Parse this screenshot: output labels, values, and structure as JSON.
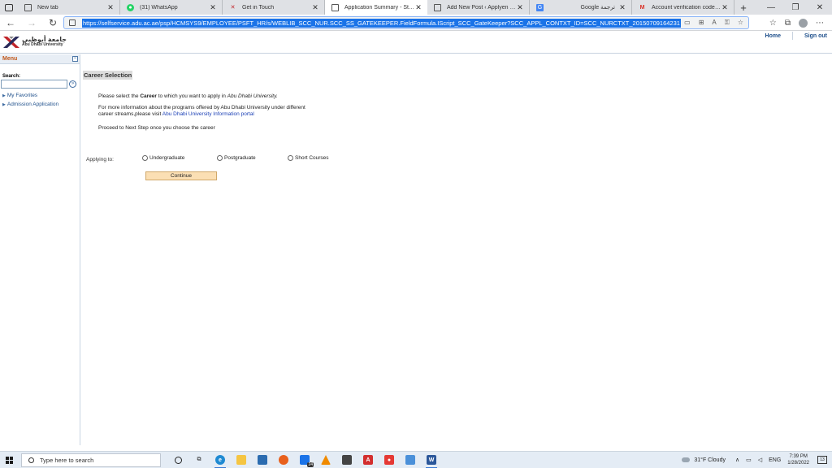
{
  "browser": {
    "tabs": [
      {
        "title": "New tab",
        "icon": "new-tab-icon",
        "active": false
      },
      {
        "title": "(31) WhatsApp",
        "icon": "whatsapp-icon",
        "active": false
      },
      {
        "title": "Get in Touch",
        "icon": "adu-icon",
        "active": false
      },
      {
        "title": "Application Summary - Student",
        "icon": "document-icon",
        "active": true
      },
      {
        "title": "Add New Post ‹ Applyen — Wo…",
        "icon": "document-icon",
        "active": false
      },
      {
        "title": "Google ترجمة",
        "icon": "google-translate-icon",
        "active": false
      },
      {
        "title": "Account verification code - ams…",
        "icon": "gmail-icon",
        "active": false
      }
    ],
    "url": "https://selfservice.adu.ac.ae/psp/HCMSYS9/EMPLOYEE/PSFT_HR/s/WEBLIB_SCC_NUR.SCC_SS_GATEKEEPER.FieldFormula.IScript_SCC_GateKeeper?SCC_APPL_CONTXT_ID=SCC_NURCTXT_20150709164231"
  },
  "header": {
    "logo_ar": "جامعة أبوظبي",
    "logo_en": "Abu Dhabi University",
    "home_label": "Home",
    "signout_label": "Sign out"
  },
  "menu": {
    "title": "Menu",
    "collapse_symbol": "−",
    "search_label": "Search:",
    "search_value": "",
    "go_symbol": "»",
    "items": [
      {
        "label": "My Favorites"
      },
      {
        "label": "Admission Application"
      }
    ]
  },
  "content": {
    "title": "Career Selection",
    "instr1_pre": "Please select the ",
    "instr1_bold": "Career",
    "instr1_mid": " to which you want to apply in ",
    "instr1_italic": "Abu Dhabi University.",
    "instr2_line1": "For more information about the programs offered by Abu Dhabi University under different",
    "instr2_line2_pre": "career streams,please visit ",
    "instr2_link": "Abu Dhabi University Information portal",
    "instr3": "Proceed to Next Step once you choose the career",
    "applying_label": "Applying to:",
    "options": [
      "Undergraduate",
      "Postgraduate",
      "Short Courses"
    ],
    "continue_label": "Continue"
  },
  "taskbar": {
    "search_placeholder": "Type here to search",
    "weather": "31°F  Cloudy",
    "lang": "ENG",
    "time": "7:39 PM",
    "date": "1/28/2022",
    "notification_count": "13",
    "calendar_badge": "24"
  }
}
